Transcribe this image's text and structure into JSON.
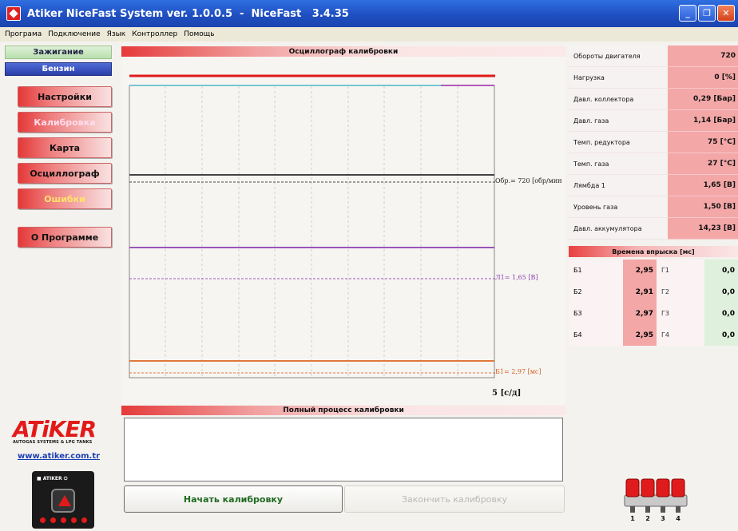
{
  "window": {
    "title": "Atiker NiceFast System ver. 1.0.0.5  -  NiceFast   3.4.35"
  },
  "menu": [
    "Програма",
    "Подключение",
    "Язык",
    "Контроллер",
    "Помощь"
  ],
  "left": {
    "ignition_label": "Зажигание",
    "fuel_label": "Бензин",
    "nav": [
      "Настройки",
      "Калибровка",
      "Карта",
      "Осциллограф",
      "Ошибки",
      "О Программе"
    ],
    "logo_text": "ATiKER",
    "logo_sub": "AUTOGAS SYSTEMS & LPG TANKS",
    "site": "www.atiker.com.tr"
  },
  "oscilloscope": {
    "title": "Осциллограф калибровки",
    "label_rpm": "Обр.= 720 [обр/мин",
    "label_lambda": "Л1= 1,65 [В]",
    "label_inj": "Б1= 2,97 [мс]",
    "scale": "5 [с/д]"
  },
  "process": {
    "title": "Полный процесс калибровки",
    "start_label": "Начать калибровку",
    "end_label": "Закончить калибровку"
  },
  "parameters": [
    {
      "name": "Обороты двигателя",
      "value": "720"
    },
    {
      "name": "Нагрузка",
      "value": "0 [%]"
    },
    {
      "name": "Давл. коллектора",
      "value": "0,29 [Бар]"
    },
    {
      "name": "Давл. газа",
      "value": "1,14 [Бар]"
    },
    {
      "name": "Темп. редуктора",
      "value": "75 [°C]"
    },
    {
      "name": "Темп. газа",
      "value": "27 [°C]"
    },
    {
      "name": "Лямбда 1",
      "value": "1,65 [В]"
    },
    {
      "name": "Уровень газа",
      "value": "1,50 [В]"
    },
    {
      "name": "Давл. аккумулятора",
      "value": "14,23 [В]"
    }
  ],
  "injection": {
    "title": "Времена впрыска [мс]",
    "rows": [
      {
        "petrol_name": "Б1",
        "petrol_value": "2,95",
        "gas_name": "Г1",
        "gas_value": "0,0"
      },
      {
        "petrol_name": "Б2",
        "petrol_value": "2,91",
        "gas_name": "Г2",
        "gas_value": "0,0"
      },
      {
        "petrol_name": "Б3",
        "petrol_value": "2,97",
        "gas_name": "Г3",
        "gas_value": "0,0"
      },
      {
        "petrol_name": "Б4",
        "petrol_value": "2,95",
        "gas_name": "Г4",
        "gas_value": "0,0"
      }
    ]
  },
  "rail_numbers": [
    "1",
    "2",
    "3",
    "4"
  ],
  "colors": {
    "accent_red": "#e21a1a",
    "trace_rpm": "#444444",
    "trace_lambda": "#9a56b8",
    "trace_inj": "#e0793a",
    "trace_top": "#e01b1b",
    "trace_cyan": "#76c7d3"
  }
}
